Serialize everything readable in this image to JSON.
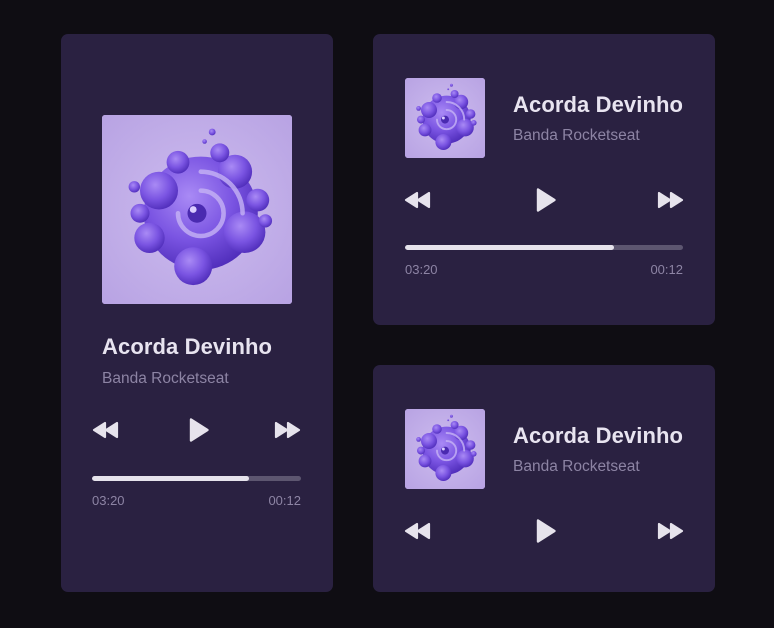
{
  "colors": {
    "background": "#0f0d13",
    "card": "#2a2141",
    "title": "#e8e4f0",
    "subtitle": "#8d84a4",
    "accent": "#7d55e6",
    "progress_fill": "#e6e3ec",
    "progress_track": "#5d5670"
  },
  "icons": {
    "rewind": "rewind-icon",
    "play": "play-icon",
    "forward": "fast-forward-icon",
    "cover": "album-cover-art"
  },
  "players": [
    {
      "title": "Acorda Devinho",
      "artist": "Banda Rocketseat",
      "progress": 0.75,
      "time_elapsed": "03:20",
      "time_remaining": "00:12"
    },
    {
      "title": "Acorda Devinho",
      "artist": "Banda Rocketseat",
      "progress": 0.75,
      "time_elapsed": "03:20",
      "time_remaining": "00:12"
    },
    {
      "title": "Acorda Devinho",
      "artist": "Banda Rocketseat"
    }
  ]
}
